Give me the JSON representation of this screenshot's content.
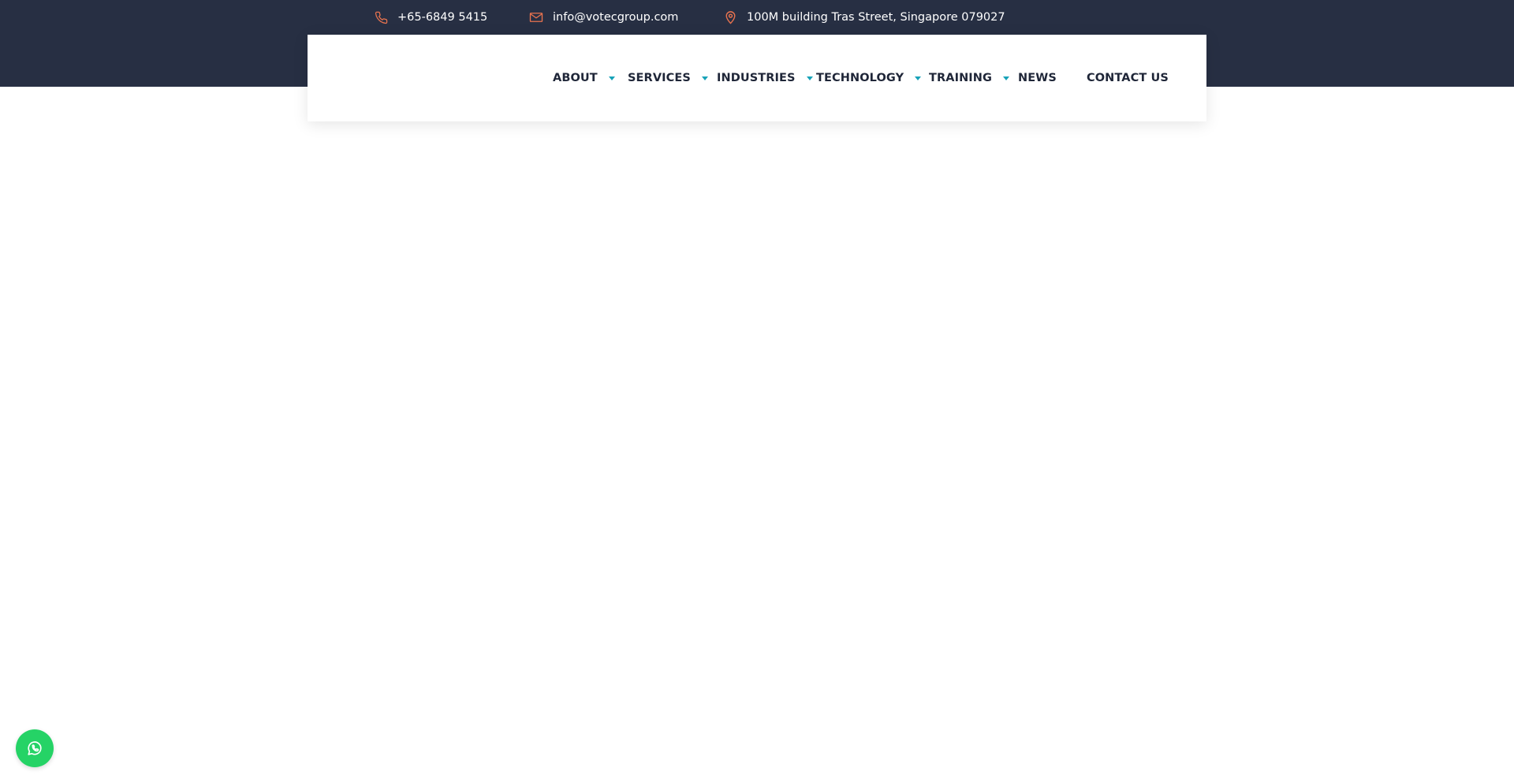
{
  "topbar": {
    "phone": {
      "text": "+65-6849 5415",
      "icon": "phone-icon"
    },
    "email": {
      "text": "info@votecgroup.com",
      "icon": "mail-icon"
    },
    "address": {
      "text": "100M building Tras Street, Singapore 079027",
      "icon": "location-pin-icon"
    }
  },
  "nav": {
    "items": [
      {
        "label": "ABOUT",
        "has_dropdown": true
      },
      {
        "label": "SERVICES",
        "has_dropdown": true
      },
      {
        "label": "INDUSTRIES",
        "has_dropdown": true
      },
      {
        "label": "TECHNOLOGY",
        "has_dropdown": true
      },
      {
        "label": "TRAINING",
        "has_dropdown": true
      },
      {
        "label": "NEWS",
        "has_dropdown": false
      },
      {
        "label": "CONTACT US",
        "has_dropdown": false
      }
    ]
  },
  "floating": {
    "whatsapp_icon": "whatsapp-icon"
  },
  "colors": {
    "topbar_bg": "#272f43",
    "accent_icon": "#e8734f",
    "caret": "#17a2b8",
    "nav_text": "#1f2638",
    "whatsapp": "#25d366"
  }
}
